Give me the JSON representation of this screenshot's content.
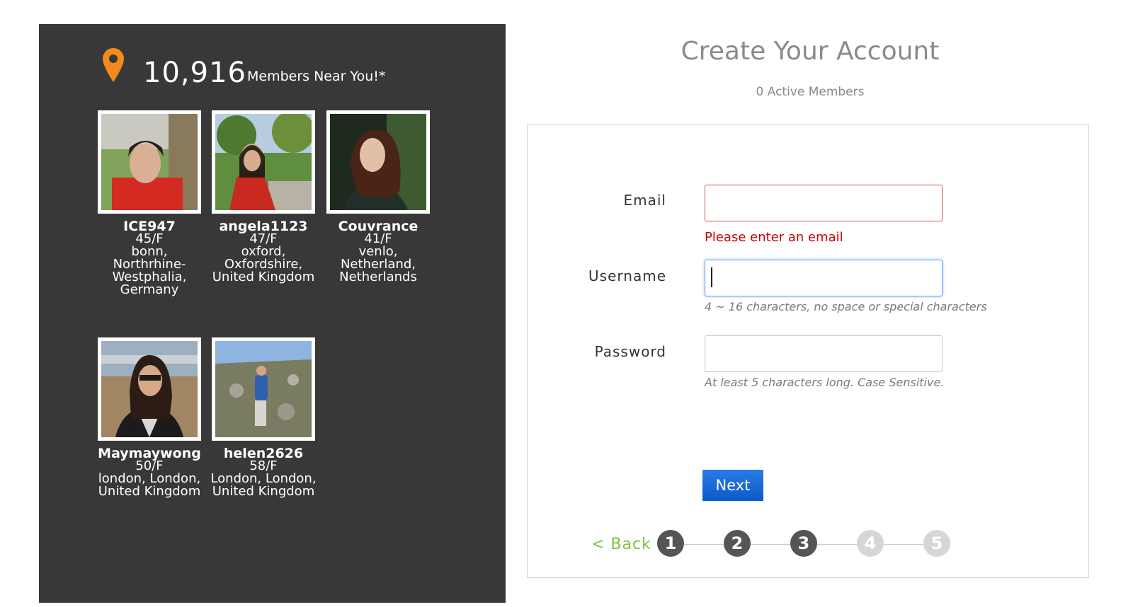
{
  "panel": {
    "count": "10,916",
    "count_label": "Members Near You!*",
    "members": [
      {
        "name": "ICE947",
        "age": "45/F",
        "location": [
          "bonn,",
          "Northrhine-",
          "Westphalia,",
          "Germany"
        ]
      },
      {
        "name": "angela1123",
        "age": "47/F",
        "location": [
          "oxford,",
          "Oxfordshire,",
          "United Kingdom"
        ]
      },
      {
        "name": "Couvrance",
        "age": "41/F",
        "location": [
          "venlo,",
          "Netherland,",
          "Netherlands"
        ]
      },
      {
        "name": "Maymaywong",
        "age": "50/F",
        "location": [
          "london, London,",
          "United Kingdom"
        ]
      },
      {
        "name": "helen2626",
        "age": "58/F",
        "location": [
          "London, London,",
          "United Kingdom"
        ]
      }
    ]
  },
  "form": {
    "title": "Create Your Account",
    "active_members": "0 Active Members",
    "email": {
      "label": "Email",
      "value": "",
      "error": "Please enter an email"
    },
    "username": {
      "label": "Username",
      "value": "",
      "hint": "4 ~ 16 characters, no space or special characters"
    },
    "password": {
      "label": "Password",
      "value": "",
      "hint": "At least 5 characters long. Case Sensitive."
    },
    "next_label": "Next",
    "back_label": "< Back",
    "steps": [
      "1",
      "2",
      "3",
      "4",
      "5"
    ],
    "current_step": 3
  },
  "colors": {
    "panel_bg": "#383838",
    "pin": "#f28a1e",
    "error": "#cc0000",
    "back": "#7dc142",
    "button": "#0b5bc9"
  }
}
